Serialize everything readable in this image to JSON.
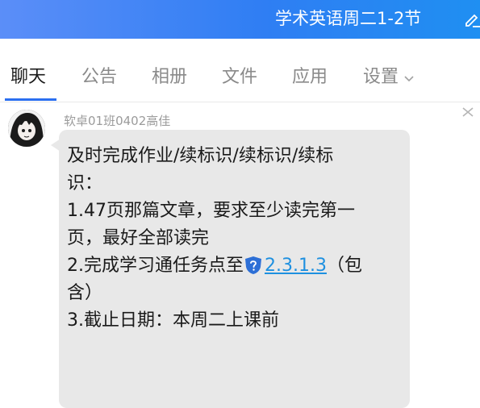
{
  "window": {
    "title": "学术英语周二1-2节"
  },
  "tabs": [
    {
      "label": "聊天",
      "active": true
    },
    {
      "label": "公告",
      "active": false
    },
    {
      "label": "相册",
      "active": false
    },
    {
      "label": "文件",
      "active": false
    },
    {
      "label": "应用",
      "active": false
    },
    {
      "label": "设置",
      "active": false
    }
  ],
  "message": {
    "sender": "软卓01班0402高佳",
    "lines": {
      "l1": "及时完成作业/续标识/续标识/续标",
      "l2": "识：",
      "l3": "1.47页那篇文章，要求至少读完第一",
      "l4": "页，最好全部读完",
      "l5_prefix": "2.完成学习通任务点至",
      "l5_link": "2.3.1.3",
      "l5_suffix": "（包",
      "l6": "含）",
      "l7": "3.截止日期：本周二上课前"
    }
  },
  "icons": {
    "edit": "pencil-icon",
    "close": "close-icon",
    "settings_dropdown": "chevron-down-icon",
    "link_badge": "shield-question-icon"
  },
  "colors": {
    "titlebar": "#2f7ef3",
    "tab_underline": "#2b6ff0",
    "bubble": "#e8e8e8",
    "link": "#1e90e0",
    "shield": "#2d6fd6"
  }
}
